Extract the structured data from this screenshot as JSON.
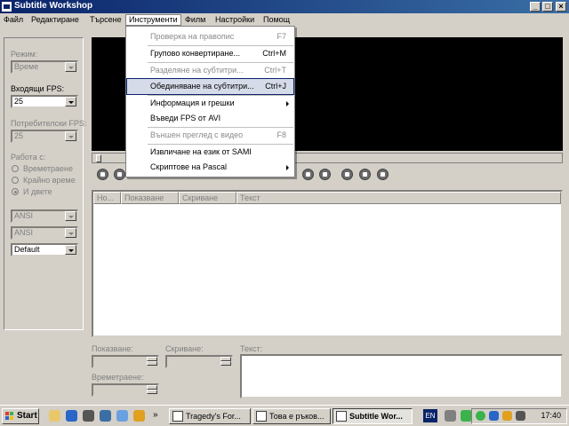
{
  "window": {
    "title": "Subtitle Workshop"
  },
  "menubar": {
    "items": [
      {
        "label": "Файл"
      },
      {
        "label": "Редактиране"
      },
      {
        "label": "Търсене"
      },
      {
        "label": "Инструменти"
      },
      {
        "label": "Филм"
      },
      {
        "label": "Настройки"
      },
      {
        "label": "Помощ"
      }
    ]
  },
  "tools_menu": {
    "items": [
      {
        "label": "Проверка на правопис",
        "shortcut": "F7",
        "enabled": false
      },
      {
        "label": "Групово конвертиране...",
        "shortcut": "Ctrl+M",
        "enabled": true
      },
      {
        "label": "Разделяне на субтитри...",
        "shortcut": "Ctrl+T",
        "enabled": false
      },
      {
        "label": "Обединяване на субтитри...",
        "shortcut": "Ctrl+J",
        "enabled": true,
        "highlighted": true
      },
      {
        "label": "Информация и грешки",
        "shortcut": "",
        "enabled": true,
        "submenu": true
      },
      {
        "label": "Въведи FPS от AVI",
        "shortcut": "",
        "enabled": true
      },
      {
        "label": "Външен преглед с видео",
        "shortcut": "F8",
        "enabled": false
      },
      {
        "label": "Извличане на език от SAMI",
        "shortcut": "",
        "enabled": true
      },
      {
        "label": "Скриптове на Pascal",
        "shortcut": "",
        "enabled": true,
        "submenu": true
      }
    ]
  },
  "left_panel": {
    "mode_label": "Режим:",
    "mode_value": "Време",
    "input_fps_label": "Входящи FPS:",
    "input_fps_value": "25",
    "user_fps_label": "Потребителски FPS:",
    "user_fps_value": "25",
    "work_with_label": "Работа с:",
    "radio_duration": "Времетраене",
    "radio_end_time": "Крайно време",
    "radio_both": "И двете",
    "encoding1": "ANSI",
    "encoding2": "ANSI",
    "style": "Default"
  },
  "grid": {
    "columns": [
      "Но...",
      "Показване",
      "Скриване",
      "Текст"
    ]
  },
  "editor": {
    "show_label": "Показване:",
    "hide_label": "Скриване:",
    "text_label": "Текст:",
    "duration_label": "Времетраене:"
  },
  "taskbar": {
    "start_label": "Start",
    "tasks": [
      {
        "label": "Tragedy's For..."
      },
      {
        "label": "Това е ръков..."
      },
      {
        "label": "Subtitle Wor..."
      }
    ],
    "language": "EN",
    "clock": "17:40"
  },
  "colors": {
    "titlebar": "#0a246a",
    "face": "#d4d0c8",
    "video": "#000000"
  }
}
